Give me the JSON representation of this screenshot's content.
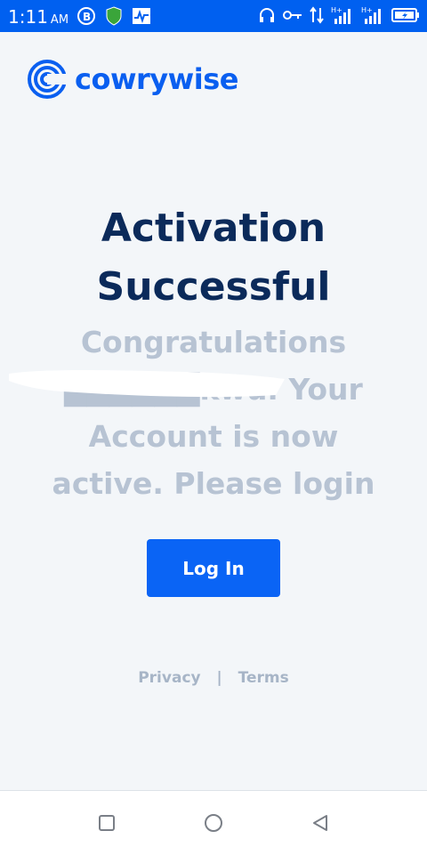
{
  "status_bar": {
    "time": "1:11",
    "ampm": "AM"
  },
  "logo": {
    "text": "cowrywise"
  },
  "heading": {
    "line1": "Activation",
    "line2": "Successful"
  },
  "message": {
    "text": "Congratulations ██████kwu. Your Account is now active. Please login"
  },
  "login_button": {
    "label": "Log In"
  },
  "footer": {
    "privacy": "Privacy",
    "separator": "|",
    "terms": "Terms"
  },
  "icons": {
    "left": [
      "bitcoin-icon",
      "shield-icon",
      "activity-icon"
    ],
    "right": [
      "headphones-icon",
      "key-icon",
      "data-arrows-icon",
      "signal-icon",
      "signal-icon",
      "battery-icon"
    ],
    "nav": [
      "recents-square-icon",
      "home-circle-icon",
      "back-triangle-icon"
    ]
  },
  "colors": {
    "primary": "#0a64f5",
    "status_bar": "#0060f0",
    "heading": "#0b2a5a",
    "message": "#b7c3d3",
    "footer": "#a7b5c7"
  }
}
